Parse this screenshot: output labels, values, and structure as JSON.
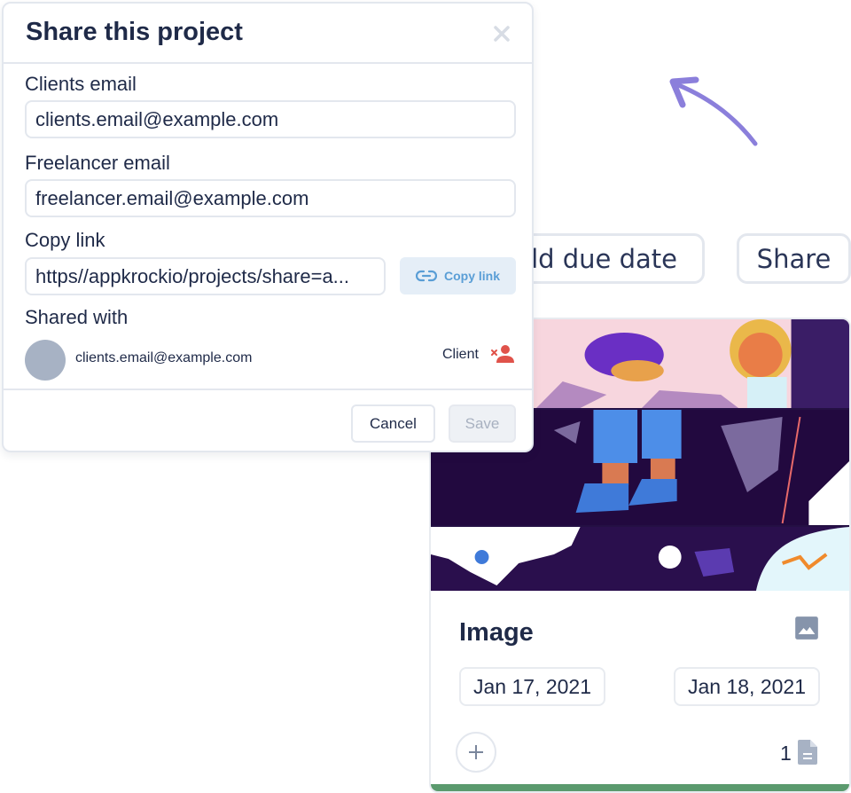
{
  "modal": {
    "title": "Share this project",
    "close_icon": "close-icon",
    "fields": {
      "clients_email": {
        "label": "Clients email",
        "value": "clients.email@example.com"
      },
      "freelancer_email": {
        "label": "Freelancer email",
        "value": "freelancer.email@example.com"
      },
      "copy_link": {
        "label": "Copy link",
        "value": "https//appkrockio/projects/share=a...",
        "button_label": "Copy link",
        "button_icon": "link-icon"
      }
    },
    "shared_with": {
      "label": "Shared with",
      "entries": [
        {
          "email": "clients.email@example.com",
          "role": "Client",
          "remove_icon": "remove-user-icon"
        }
      ]
    },
    "footer": {
      "cancel_label": "Cancel",
      "save_label": "Save"
    }
  },
  "background": {
    "buttons": {
      "add_due_date": "dd due date",
      "share": "Share"
    },
    "arrow_icon": "arrow-up-left-icon",
    "card": {
      "title": "Image",
      "type_icon": "image-icon",
      "start_date": "Jan 17, 2021",
      "end_date": "Jan 18, 2021",
      "add_icon": "plus-icon",
      "file_count": "1",
      "file_icon": "file-icon"
    }
  },
  "colors": {
    "text_primary": "#1f2a48",
    "border": "#e3e7ee",
    "copy_button_bg": "#e5eef7",
    "copy_button_text": "#5a9ed6",
    "remove_user": "#e0524a",
    "avatar": "#a7b2c4",
    "arrow": "#8b7fdb",
    "card_status_bar": "#5b9a6e"
  }
}
